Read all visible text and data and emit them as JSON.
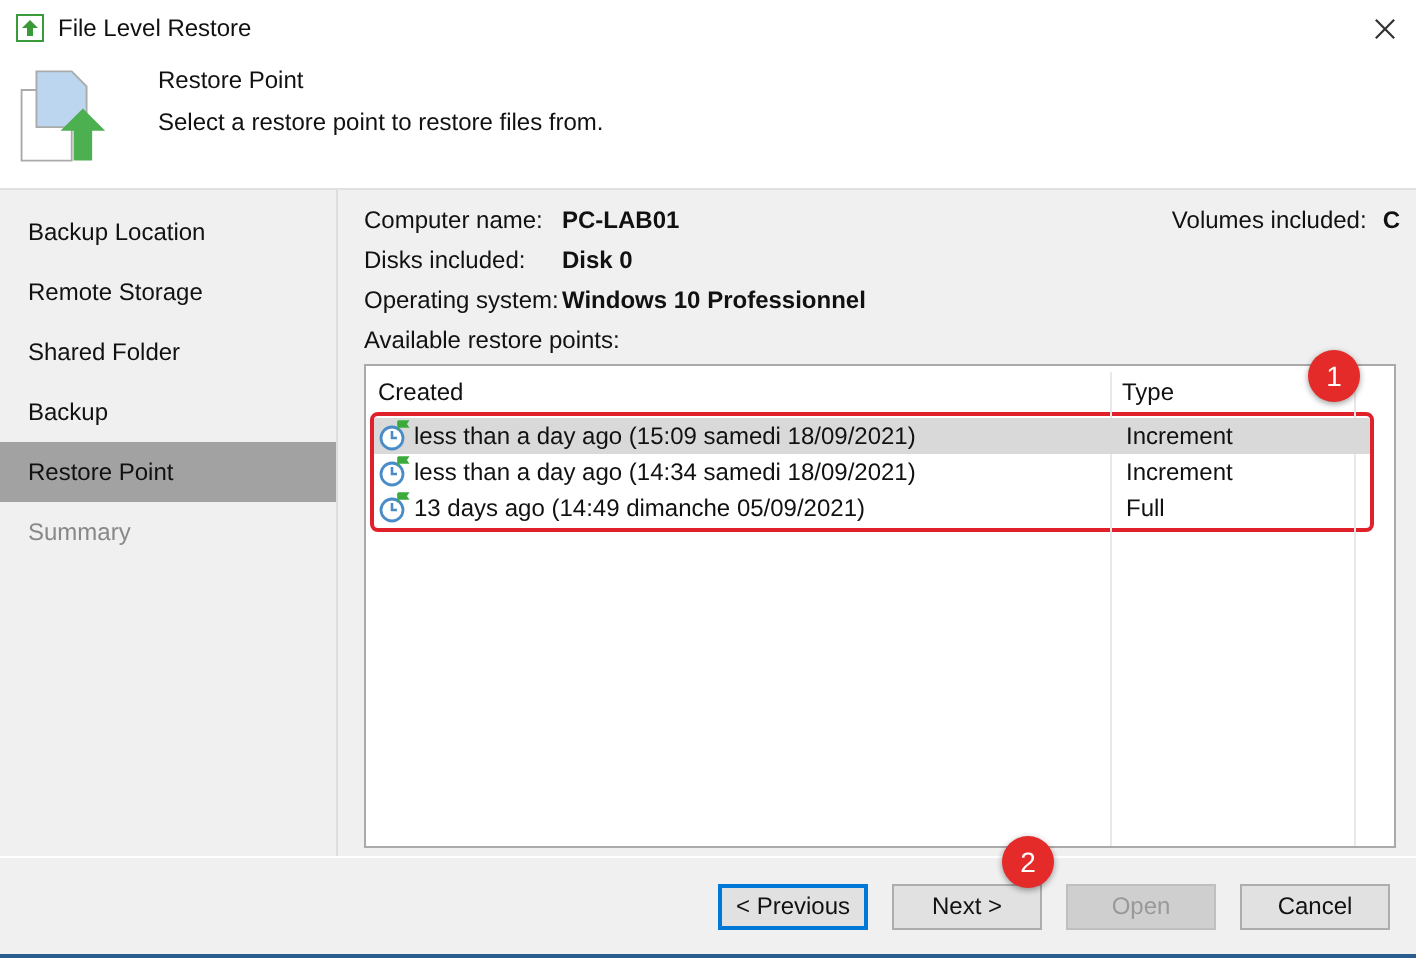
{
  "window": {
    "title": "File Level Restore"
  },
  "header": {
    "title": "Restore Point",
    "subtitle": "Select a restore point to restore files from."
  },
  "sidebar": {
    "items": [
      {
        "label": "Backup Location",
        "selected": false,
        "disabled": false
      },
      {
        "label": "Remote Storage",
        "selected": false,
        "disabled": false
      },
      {
        "label": "Shared Folder",
        "selected": false,
        "disabled": false
      },
      {
        "label": "Backup",
        "selected": false,
        "disabled": false
      },
      {
        "label": "Restore Point",
        "selected": true,
        "disabled": false
      },
      {
        "label": "Summary",
        "selected": false,
        "disabled": true
      }
    ]
  },
  "details": {
    "computer_label": "Computer name:",
    "computer": "PC-LAB01",
    "volumes_label": "Volumes included:",
    "volumes": "C",
    "disks_label": "Disks included:",
    "disks": "Disk 0",
    "os_label": "Operating system:",
    "os": "Windows 10 Professionnel"
  },
  "restore_points": {
    "label": "Available restore points:",
    "highlighted": true,
    "badge": "1",
    "columns": [
      "Created",
      "Type"
    ],
    "rows": [
      {
        "created": "less than a day ago (15:09 samedi 18/09/2021)",
        "type": "Increment",
        "selected": true
      },
      {
        "created": "less than a day ago (14:34 samedi 18/09/2021)",
        "type": "Increment",
        "selected": false
      },
      {
        "created": "13 days ago (14:49 dimanche 05/09/2021)",
        "type": "Full",
        "selected": false
      }
    ]
  },
  "buttons": [
    {
      "label": "< Previous",
      "disabled": false,
      "focused": true
    },
    {
      "label": "Next >",
      "disabled": false,
      "focused": false,
      "badge": "2"
    },
    {
      "label": "Open",
      "disabled": true,
      "focused": false
    },
    {
      "label": "Cancel",
      "disabled": false,
      "focused": false
    }
  ]
}
